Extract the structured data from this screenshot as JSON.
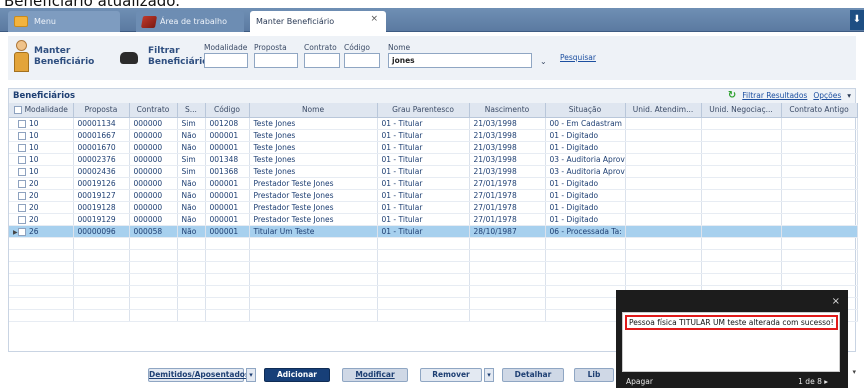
{
  "caption": "Beneficiário atualizado.",
  "tabs": {
    "menu": "Menu",
    "area": "Área de trabalho",
    "active": "Manter Beneficiário"
  },
  "header": {
    "manter_line1": "Manter",
    "manter_line2": "Beneficiário",
    "filtrar_line1": "Filtrar",
    "filtrar_line2": "Beneficiário"
  },
  "filters": {
    "modalidade_label": "Modalidade",
    "proposta_label": "Proposta",
    "contrato_label": "Contrato",
    "codigo_label": "Código",
    "nome_label": "Nome",
    "nome_value": "jones",
    "pesquisar": "Pesquisar"
  },
  "grid": {
    "title": "Beneficiários",
    "filtrar_resultados": "Filtrar Resultados",
    "opcoes": "Opções",
    "columns": [
      "Modalidade",
      "Proposta",
      "Contrato",
      "S...",
      "Código",
      "Nome",
      "Grau Parentesco",
      "Nascimento",
      "Situação",
      "Unid. Atendim...",
      "Unid. Negociaç...",
      "Contrato Antigo"
    ],
    "rows": [
      [
        "10",
        "00001134",
        "000000",
        "Sim",
        "001208",
        "Teste Jones",
        "01 - Titular",
        "21/03/1998",
        "00 - Em Cadastram",
        "",
        "",
        ""
      ],
      [
        "10",
        "00001667",
        "000000",
        "Não",
        "000001",
        "Teste Jones",
        "01 - Titular",
        "21/03/1998",
        "01 - Digitado",
        "",
        "",
        ""
      ],
      [
        "10",
        "00001670",
        "000000",
        "Não",
        "000001",
        "Teste Jones",
        "01 - Titular",
        "21/03/1998",
        "01 - Digitado",
        "",
        "",
        ""
      ],
      [
        "10",
        "00002376",
        "000000",
        "Sim",
        "001348",
        "Teste Jones",
        "01 - Titular",
        "21/03/1998",
        "03 - Auditoria Aprov",
        "",
        "",
        ""
      ],
      [
        "10",
        "00002436",
        "000000",
        "Sim",
        "001368",
        "Teste Jones",
        "01 - Titular",
        "21/03/1998",
        "03 - Auditoria Aprov",
        "",
        "",
        ""
      ],
      [
        "20",
        "00019126",
        "000000",
        "Não",
        "000001",
        "Prestador Teste Jones",
        "01 - Titular",
        "27/01/1978",
        "01 - Digitado",
        "",
        "",
        ""
      ],
      [
        "20",
        "00019127",
        "000000",
        "Não",
        "000001",
        "Prestador Teste Jones",
        "01 - Titular",
        "27/01/1978",
        "01 - Digitado",
        "",
        "",
        ""
      ],
      [
        "20",
        "00019128",
        "000000",
        "Não",
        "000001",
        "Prestador Teste Jones",
        "01 - Titular",
        "27/01/1978",
        "01 - Digitado",
        "",
        "",
        ""
      ],
      [
        "20",
        "00019129",
        "000000",
        "Não",
        "000001",
        "Prestador Teste Jones",
        "01 - Titular",
        "27/01/1978",
        "01 - Digitado",
        "",
        "",
        ""
      ],
      [
        "26",
        "00000096",
        "000058",
        "Não",
        "000001",
        "Titular Um Teste",
        "01 - Titular",
        "28/10/1987",
        "06 - Processada Ta:",
        "",
        "",
        ""
      ]
    ],
    "selected_row": 9
  },
  "buttons": {
    "demitidos": "Demitidos/Aposentados",
    "adicionar": "Adicionar",
    "modificar": "Modificar",
    "remover": "Remover",
    "detalhar": "Detalhar",
    "lib": "Lib"
  },
  "toast": {
    "message": "Pessoa física TITULAR UM teste alterada com sucesso!",
    "apagar": "Apagar",
    "pager": "1 de 8 ▸",
    "close": "×"
  }
}
